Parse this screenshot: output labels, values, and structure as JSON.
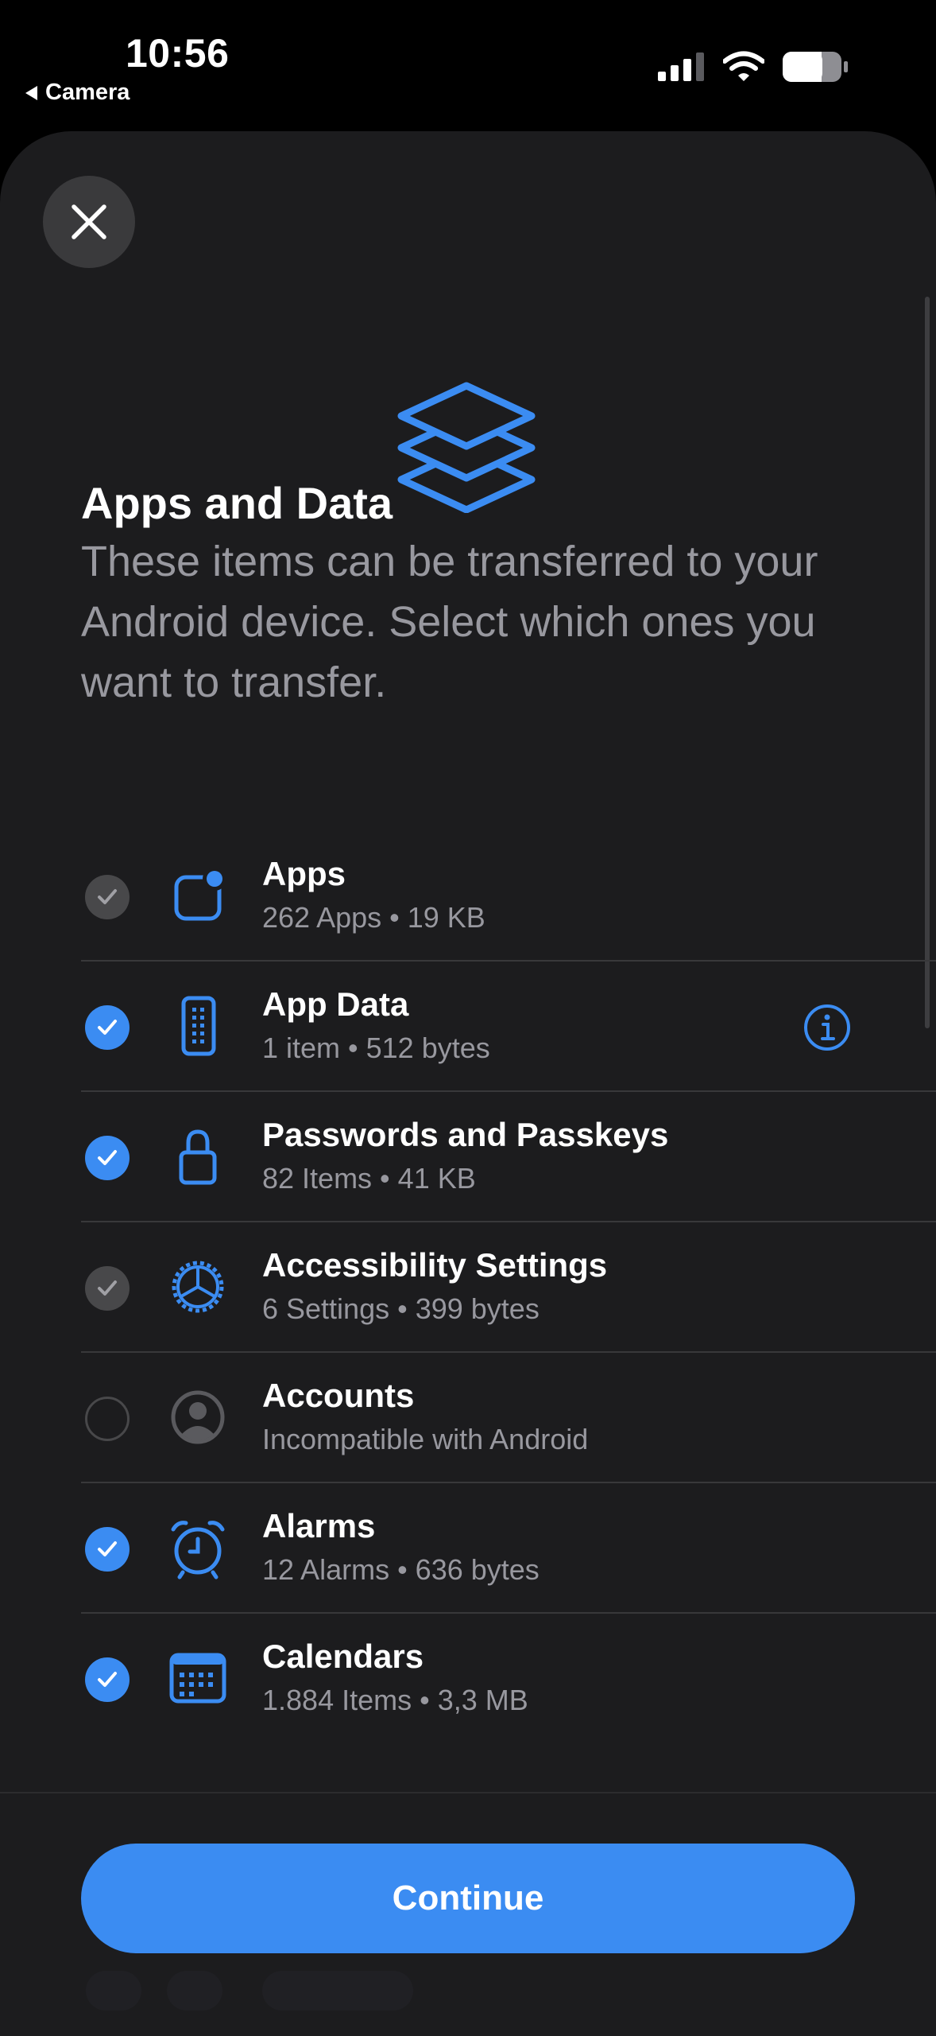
{
  "status_bar": {
    "time": "10:56",
    "back_label": "Camera",
    "signal_icon": "cellular-signal-icon",
    "wifi_icon": "wifi-icon",
    "battery_icon": "battery-icon"
  },
  "sheet": {
    "close_icon": "close-icon",
    "hero_icon": "stacked-layers-icon",
    "title": "Apps and Data",
    "subtitle": "These items can be transferred to your Android device. Select which ones you want to transfer."
  },
  "items": [
    {
      "label": "Apps",
      "detail": "262 Apps • 19 KB",
      "state": "selected-locked",
      "icon": "app-badge-icon"
    },
    {
      "label": "App Data",
      "detail": "1 item • 512 bytes",
      "state": "selected",
      "icon": "phone-icon",
      "info": true
    },
    {
      "label": "Passwords and Passkeys",
      "detail": "82 Items • 41 KB",
      "state": "selected",
      "icon": "lock-icon"
    },
    {
      "label": "Accessibility Settings",
      "detail": "6 Settings • 399 bytes",
      "state": "selected-locked",
      "icon": "accessibility-gear-icon"
    },
    {
      "label": "Accounts",
      "detail": "Incompatible with Android",
      "state": "unavailable",
      "icon": "person-circle-icon"
    },
    {
      "label": "Alarms",
      "detail": "12 Alarms • 636 bytes",
      "state": "selected",
      "icon": "alarm-clock-icon"
    },
    {
      "label": "Calendars",
      "detail": "1.884 Items • 3,3 MB",
      "state": "selected",
      "icon": "calendar-icon"
    }
  ],
  "footer": {
    "continue_label": "Continue"
  },
  "colors": {
    "accent": "#3b8cf2",
    "background": "#1c1c1e",
    "secondary_text": "#98989f"
  }
}
